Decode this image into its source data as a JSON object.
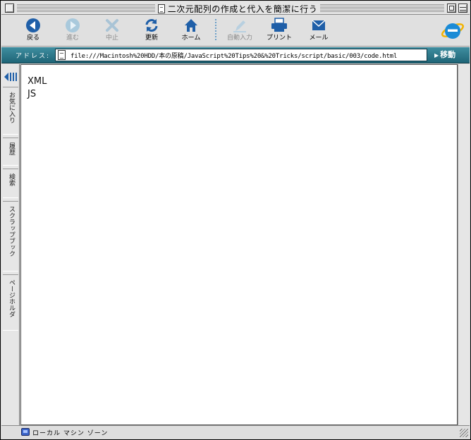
{
  "window": {
    "title": "二次元配列の作成と代入を簡潔に行う"
  },
  "toolbar": {
    "buttons": [
      {
        "label": "戻る",
        "icon": "back-arrow-icon",
        "enabled": true
      },
      {
        "label": "進む",
        "icon": "forward-arrow-icon",
        "enabled": false
      },
      {
        "label": "中止",
        "icon": "stop-icon",
        "enabled": false
      },
      {
        "label": "更新",
        "icon": "refresh-icon",
        "enabled": true
      },
      {
        "label": "ホーム",
        "icon": "home-icon",
        "enabled": true
      },
      {
        "label": "自動入力",
        "icon": "autofill-icon",
        "enabled": false
      },
      {
        "label": "プリント",
        "icon": "printer-icon",
        "enabled": true
      },
      {
        "label": "メール",
        "icon": "mail-icon",
        "enabled": true
      }
    ],
    "accent": "#1f5fa8"
  },
  "address": {
    "label": "アドレス:",
    "url": "file:///Macintosh%20HDD/本の原稿/JavaScript%20Tips%20&%20Tricks/script/basic/003/code.html",
    "go_label": "移動"
  },
  "sidebar": {
    "tabs": [
      "お気に入り",
      "履歴",
      "検索",
      "スクラップブック",
      "ページホルダ"
    ]
  },
  "content": {
    "lines": [
      "XML",
      "JS"
    ]
  },
  "status": {
    "zone": "ローカル マシン ゾーン"
  }
}
